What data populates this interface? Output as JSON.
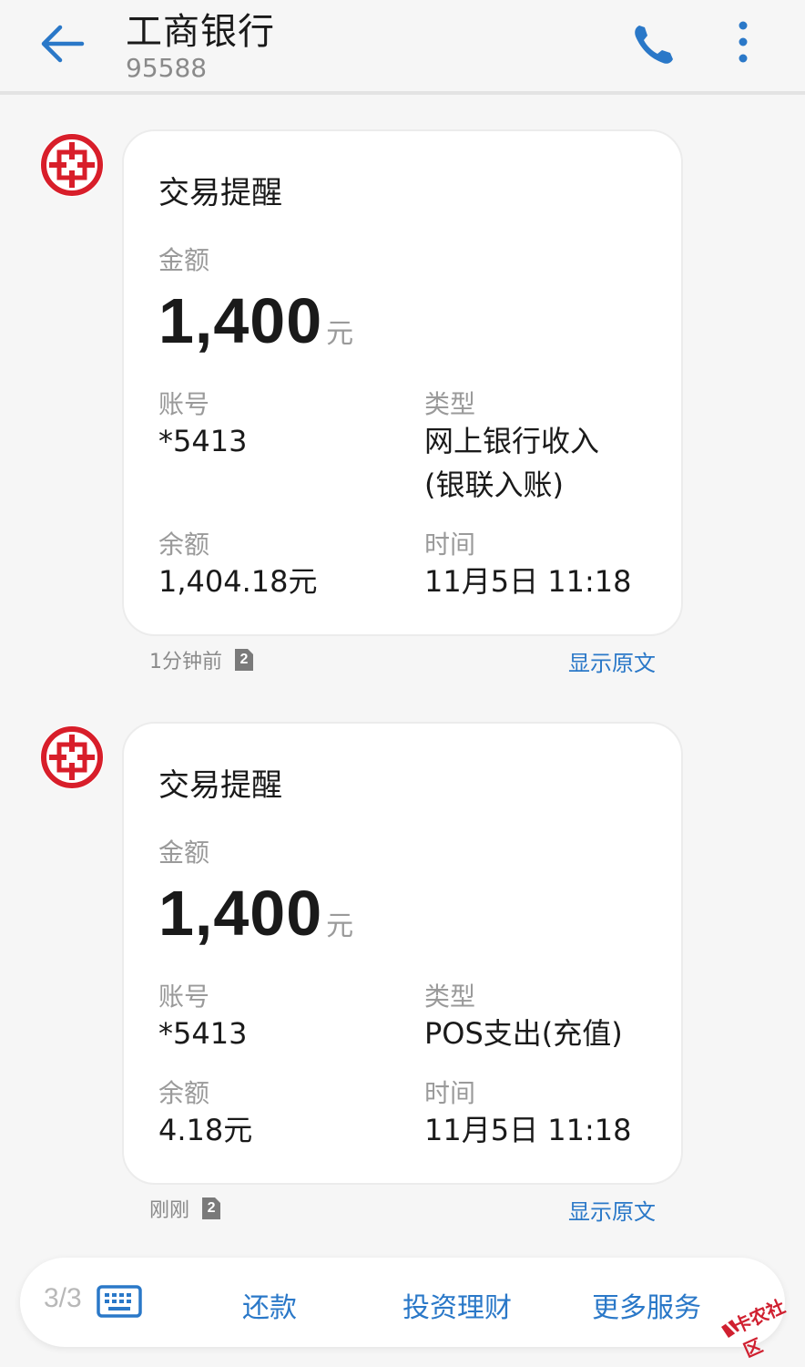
{
  "header": {
    "title": "工商银行",
    "subtitle": "95588",
    "back_icon": "arrow-left-icon",
    "call_icon": "phone-icon",
    "more_icon": "more-vertical-icon",
    "accent_color": "#2a78c8"
  },
  "messages": [
    {
      "title": "交易提醒",
      "amount_label": "金额",
      "amount": "1,400",
      "amount_unit": "元",
      "account_label": "账号",
      "account": "*5413",
      "type_label": "类型",
      "type_line1": "网上银行收入",
      "type_line2": "(银联入账)",
      "balance_label": "余额",
      "balance": "1,404.18元",
      "time_label": "时间",
      "time": "11月5日 11:18",
      "timestamp": "1分钟前",
      "sim": "2",
      "show_raw": "显示原文"
    },
    {
      "title": "交易提醒",
      "amount_label": "金额",
      "amount": "1,400",
      "amount_unit": "元",
      "account_label": "账号",
      "account": "*5413",
      "type_label": "类型",
      "type_line1": "POS支出(充值)",
      "balance_label": "余额",
      "balance": "4.18元",
      "time_label": "时间",
      "time": "11月5日 11:18",
      "timestamp": "刚刚",
      "sim": "2",
      "show_raw": "显示原文"
    }
  ],
  "bottom_bar": {
    "counter": "3/3",
    "keyboard_icon": "keyboard-icon",
    "items": [
      "还款",
      "投资理财",
      "更多服务"
    ]
  },
  "watermark": "卡农社区"
}
